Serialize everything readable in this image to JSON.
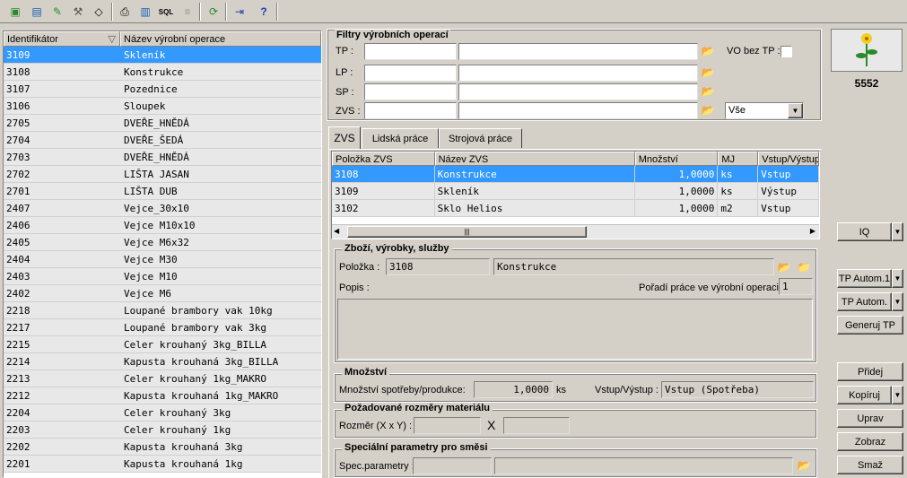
{
  "toolbar": {
    "icons": [
      "new-icon",
      "open-icon",
      "edit-icon",
      "tools-icon",
      "eraser-icon",
      "print-icon",
      "export-icon",
      "sql-icon",
      "doc-icon",
      "refresh-icon",
      "exit-icon",
      "help-icon"
    ],
    "sql_label": "SQL"
  },
  "list": {
    "col_id": "Identifikátor",
    "col_name": "Název výrobní operace",
    "rows": [
      {
        "id": "3109",
        "name": "Skleník"
      },
      {
        "id": "3108",
        "name": "Konstrukce"
      },
      {
        "id": "3107",
        "name": "Pozednice"
      },
      {
        "id": "3106",
        "name": "Sloupek"
      },
      {
        "id": "2705",
        "name": "DVEŘE_HNĚDÁ"
      },
      {
        "id": "2704",
        "name": "DVEŘE_ŠEDÁ"
      },
      {
        "id": "2703",
        "name": "DVEŘE_HNĚDÁ"
      },
      {
        "id": "2702",
        "name": "LIŠTA JASAN"
      },
      {
        "id": "2701",
        "name": "LIŠTA DUB"
      },
      {
        "id": "2407",
        "name": "Vejce_30x10"
      },
      {
        "id": "2406",
        "name": "Vejce M10x10"
      },
      {
        "id": "2405",
        "name": "Vejce M6x32"
      },
      {
        "id": "2404",
        "name": "Vejce M30"
      },
      {
        "id": "2403",
        "name": "Vejce M10"
      },
      {
        "id": "2402",
        "name": "Vejce M6"
      },
      {
        "id": "2218",
        "name": "Loupané brambory vak 10kg"
      },
      {
        "id": "2217",
        "name": "Loupané brambory vak 3kg"
      },
      {
        "id": "2215",
        "name": "Celer krouhaný 3kg_BILLA"
      },
      {
        "id": "2214",
        "name": "Kapusta krouhaná 3kg_BILLA"
      },
      {
        "id": "2213",
        "name": "Celer krouhaný 1kg_MAKRO"
      },
      {
        "id": "2212",
        "name": "Kapusta krouhaná 1kg_MAKRO"
      },
      {
        "id": "2204",
        "name": "Celer krouhaný 3kg"
      },
      {
        "id": "2203",
        "name": "Celer krouhaný 1kg"
      },
      {
        "id": "2202",
        "name": "Kapusta krouhaná 3kg"
      },
      {
        "id": "2201",
        "name": "Kapusta krouhaná 1kg"
      }
    ]
  },
  "filters": {
    "title": "Filtry výrobních operací",
    "tp_label": "TP :",
    "lp_label": "LP :",
    "sp_label": "SP :",
    "zvs_label": "ZVS :",
    "vo_label": "VO bez TP :",
    "select_value": "Vše"
  },
  "tabs": {
    "zvs": "ZVS",
    "lidska": "Lidská práce",
    "strojova": "Strojová práce"
  },
  "zvs_grid": {
    "cols": [
      "Položka ZVS",
      "Název ZVS",
      "Množství",
      "MJ",
      "Vstup/Výstup"
    ],
    "rows": [
      {
        "polozka": "3108",
        "nazev": "Konstrukce",
        "mnozstvi": "1,0000",
        "mj": "ks",
        "vv": "Vstup"
      },
      {
        "polozka": "3109",
        "nazev": "Skleník",
        "mnozstvi": "1,0000",
        "mj": "ks",
        "vv": "Výstup"
      },
      {
        "polozka": "3102",
        "nazev": "Sklo Helios",
        "mnozstvi": "1,0000",
        "mj": "m2",
        "vv": "Vstup"
      }
    ]
  },
  "goods": {
    "title": "Zboží, výrobky, služby",
    "polozka_label": "Položka :",
    "polozka_code": "3108",
    "polozka_name": "Konstrukce",
    "popis_label": "Popis :",
    "poradi_label": "Pořadí práce ve výrobní operaci:",
    "poradi_value": "1"
  },
  "qty": {
    "title": "Množství",
    "label": "Množství spotřeby/produkce:",
    "value": "1,0000",
    "unit": "ks",
    "vv_label": "Vstup/Výstup :",
    "vv_value": "Vstup (Spotřeba)"
  },
  "dims": {
    "title": "Požadované rozměry materiálu",
    "label": "Rozměr (X x Y) :",
    "x": "X"
  },
  "spec": {
    "title": "Speciální parametry pro směsi",
    "label": "Spec.parametry :"
  },
  "right": {
    "number": "5552",
    "iq": "IQ",
    "tp_autom1": "TP Autom.1",
    "tp_autom": "TP Autom.",
    "generuj": "Generuj TP",
    "pridej": "Přidej",
    "kopiruj": "Kopíruj",
    "uprav": "Uprav",
    "zobraz": "Zobraz",
    "smaz": "Smaž"
  }
}
